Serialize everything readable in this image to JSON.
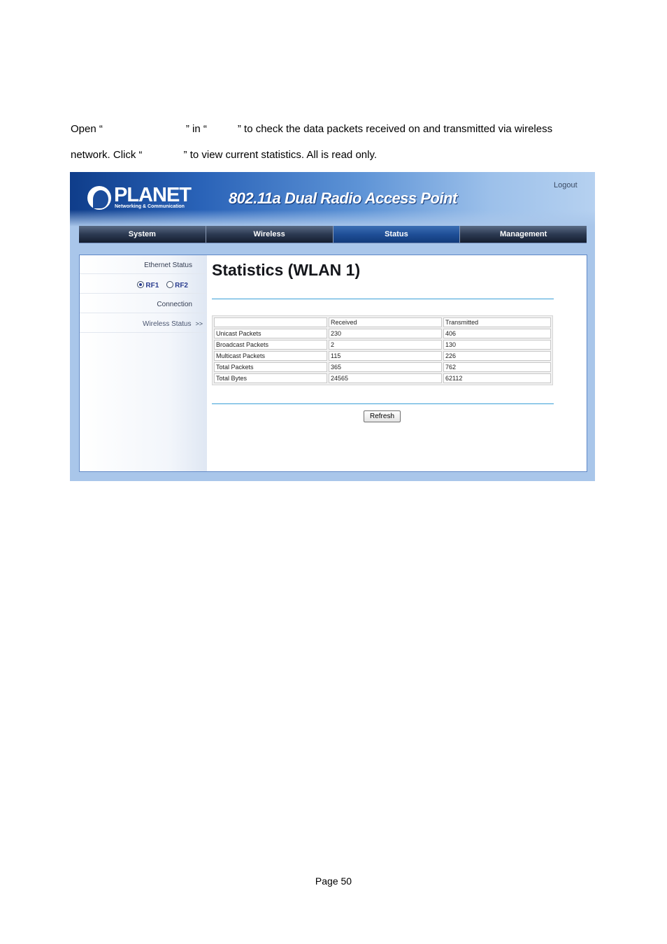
{
  "intro": {
    "l1_a": "Open “",
    "l1_b": "” in “",
    "l1_c": "” to check the data packets received on and transmitted via wireless",
    "l2_a": "network. Click “",
    "l2_b": "” to view current statistics. All is read only."
  },
  "header": {
    "logo": "PLANET",
    "logo_sub": "Networking & Communication",
    "product": "802.11a Dual Radio Access Point",
    "logout": "Logout"
  },
  "nav": {
    "tabs": [
      "System",
      "Wireless",
      "Status",
      "Management"
    ],
    "active": "Status"
  },
  "sidebar": {
    "ethernet": "Ethernet Status",
    "rf1": "RF1",
    "rf2": "RF2",
    "rf_selected": "RF1",
    "connection": "Connection",
    "wireless": "Wireless Status",
    "arrows": ">>"
  },
  "main": {
    "title": "Statistics (WLAN 1)",
    "refresh": "Refresh",
    "table": {
      "headers": [
        "",
        "Received",
        "Transmitted"
      ],
      "rows": [
        [
          "Unicast Packets",
          "230",
          "406"
        ],
        [
          "Broadcast Packets",
          "2",
          "130"
        ],
        [
          "Multicast Packets",
          "115",
          "226"
        ],
        [
          "Total Packets",
          "365",
          "762"
        ],
        [
          "Total Bytes",
          "24565",
          "62112"
        ]
      ]
    }
  },
  "footer": {
    "page": "Page 50"
  }
}
